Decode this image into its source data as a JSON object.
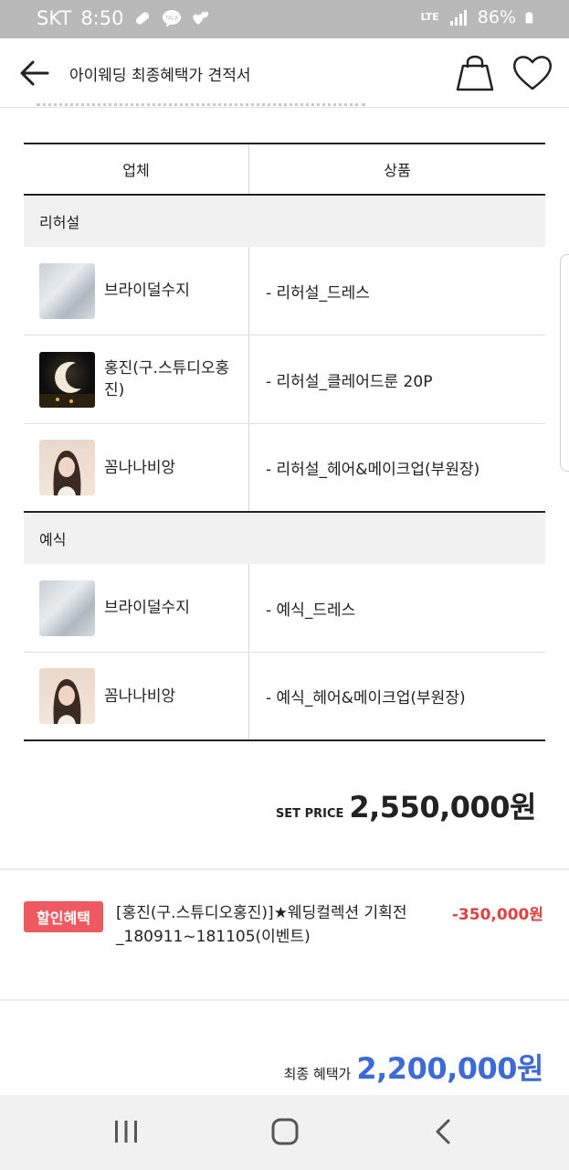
{
  "status_bar": {
    "carrier": "SKT",
    "time": "8:50",
    "network": "LTE",
    "battery": "86%",
    "icons": [
      "pill-icon",
      "talk-icon",
      "hearts-icon",
      "signal-icon",
      "battery-icon"
    ]
  },
  "header": {
    "title": "아이웨딩 최종혜택가 견적서",
    "icons": [
      "back-arrow-icon",
      "shopping-bag-icon",
      "heart-icon"
    ]
  },
  "table": {
    "headers": [
      "업체",
      "상품"
    ],
    "sections": [
      {
        "title": "리허설",
        "rows": [
          {
            "vendor": "브라이덜수지",
            "product": "- 리허설_드레스",
            "thumb": "dress"
          },
          {
            "vendor": "홍진(구.스튜디오홍진)",
            "product": "- 리허설_클레어드룬 20P",
            "thumb": "moon"
          },
          {
            "vendor": "꼼나나비앙",
            "product": "- 리허설_헤어&메이크업(부원장)",
            "thumb": "hair"
          }
        ]
      },
      {
        "title": "예식",
        "rows": [
          {
            "vendor": "브라이덜수지",
            "product": "- 예식_드레스",
            "thumb": "dress"
          },
          {
            "vendor": "꼼나나비앙",
            "product": "- 예식_헤어&메이크업(부원장)",
            "thumb": "hair"
          }
        ]
      }
    ]
  },
  "set_price": {
    "label": "SET PRICE",
    "value": "2,550,000원"
  },
  "discount": {
    "badge": "할인혜택",
    "description": "[홍진(구.스튜디오홍진)]★웨딩컬렉션 기획전_180911~181105(이벤트)",
    "amount": "-350,000원"
  },
  "final_price": {
    "label": "최종 혜택가",
    "value": "2,200,000원"
  },
  "colors": {
    "discount_badge": "#ef5a62",
    "discount_amount": "#e0413f",
    "final_price": "#3d6bd6",
    "status_bar": "#b9b9b9"
  },
  "nav_bar": {
    "icons": [
      "recent-apps-icon",
      "home-icon",
      "back-icon"
    ]
  }
}
